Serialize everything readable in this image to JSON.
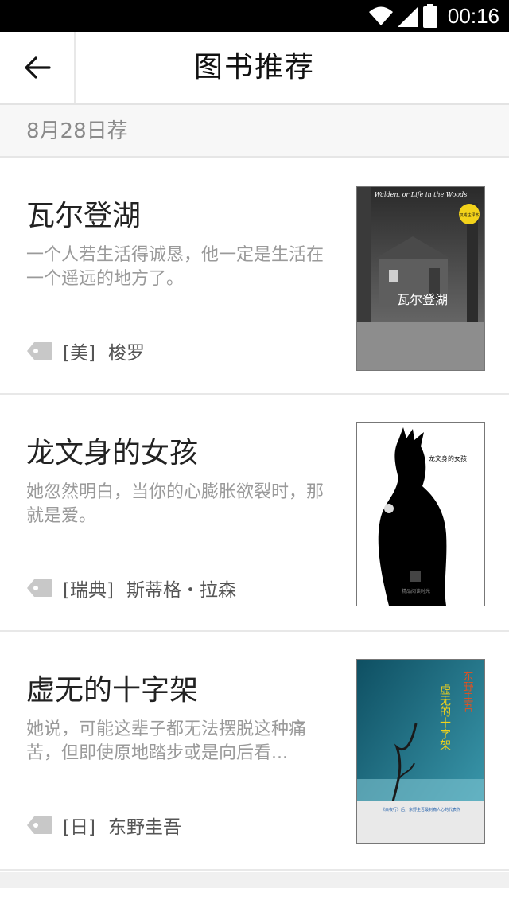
{
  "status_bar": {
    "time": "00:16",
    "icons": [
      "wifi-icon",
      "signal-icon",
      "battery-icon"
    ]
  },
  "header": {
    "title": "图书推荐",
    "back_icon": "back-arrow-icon"
  },
  "date_label": "8月28日荐",
  "books": [
    {
      "title": "瓦尔登湖",
      "description": "一个人若生活得诚恳，他一定是生活在一个遥远的地方了。",
      "country": "[美]",
      "author": "梭罗",
      "cover_title": "瓦尔登湖",
      "cover_en": "Walden, or Life in the Woods",
      "cover_badge": "权威注译本"
    },
    {
      "title": "龙文身的女孩",
      "description": "她忽然明白，当你的心膨胀欲裂时，那就是爱。",
      "country": "[瑞典]",
      "author": "斯蒂格・拉森",
      "cover_title": "龙文身的女孩",
      "cover_badge": "精品阅读时光"
    },
    {
      "title": "虚无的十字架",
      "description": "她说，可能这辈子都无法摆脱这种痛苦，但即使原地踏步或是向后看...",
      "country": "[日]",
      "author": "东野圭吾",
      "cover_title": "虚无的十字架",
      "cover_author": "东野圭吾",
      "cover_badge": "《白夜行》后，东野圭吾最刺痛人心的代表作"
    }
  ],
  "colors": {
    "status_bg": "#000000",
    "title_text": "#222222",
    "desc_text": "#9a9a9a",
    "meta_text": "#555555",
    "tag_icon": "#c8c8c8"
  }
}
